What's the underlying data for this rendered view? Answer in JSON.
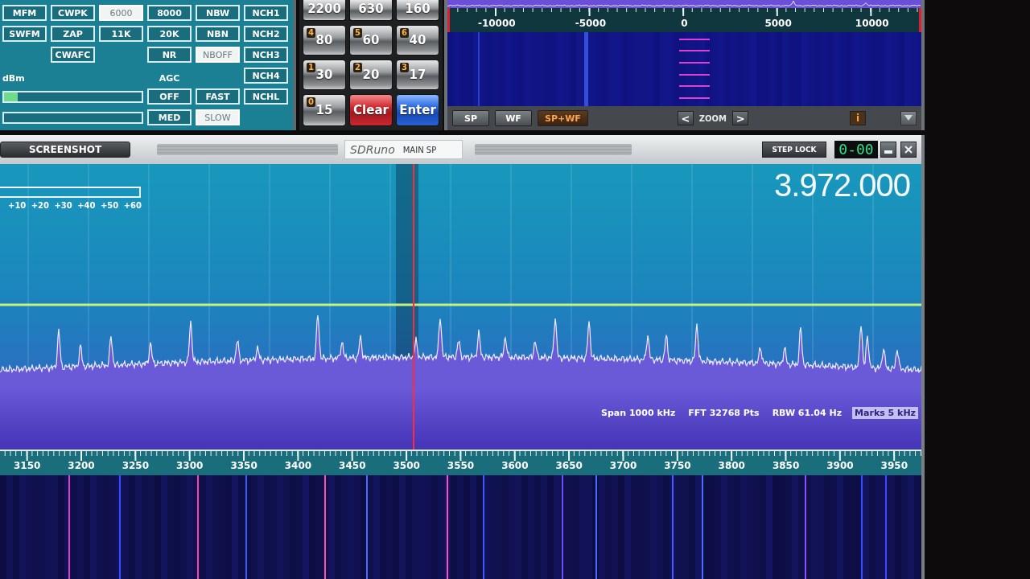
{
  "control_panel": {
    "button_rows": [
      [
        {
          "kind": "button",
          "label": "MFM",
          "selected": false
        },
        {
          "kind": "button",
          "label": "CWPK",
          "selected": false
        },
        {
          "kind": "button",
          "label": "6000",
          "selected": true
        },
        {
          "kind": "button",
          "label": "8000",
          "selected": false
        },
        {
          "kind": "button",
          "label": "NBW",
          "selected": false
        },
        {
          "kind": "button",
          "label": "NCH1",
          "selected": false
        }
      ],
      [
        {
          "kind": "button",
          "label": "SWFM",
          "selected": false
        },
        {
          "kind": "button",
          "label": "ZAP",
          "selected": false
        },
        {
          "kind": "button",
          "label": "11K",
          "selected": false
        },
        {
          "kind": "button",
          "label": "20K",
          "selected": false
        },
        {
          "kind": "button",
          "label": "NBN",
          "selected": false
        },
        {
          "kind": "button",
          "label": "NCH2",
          "selected": false
        }
      ],
      [
        {
          "kind": "gap"
        },
        {
          "kind": "button",
          "label": "CWAFC",
          "selected": false
        },
        {
          "kind": "gap"
        },
        {
          "kind": "button",
          "label": "NR",
          "selected": false
        },
        {
          "kind": "button",
          "label": "NBOFF",
          "selected": true
        },
        {
          "kind": "button",
          "label": "NCH3",
          "selected": false
        }
      ]
    ],
    "notch_buttons": [
      {
        "label": "NCH4",
        "selected": false
      },
      {
        "label": "NCHL",
        "selected": false
      }
    ],
    "signal_meter": {
      "label": "dBm",
      "level": 0.1
    },
    "agc": {
      "label": "AGC",
      "buttons": [
        {
          "label": "OFF",
          "selected": false
        },
        {
          "label": "FAST",
          "selected": false
        },
        {
          "label": "MED",
          "selected": false
        },
        {
          "label": "SLOW",
          "selected": true
        }
      ]
    }
  },
  "keypad": [
    {
      "kind": "number",
      "label": "2200"
    },
    {
      "kind": "number",
      "label": "630"
    },
    {
      "kind": "number",
      "label": "160"
    },
    {
      "kind": "number",
      "digit": "4",
      "label": "80"
    },
    {
      "kind": "number",
      "digit": "5",
      "label": "60"
    },
    {
      "kind": "number",
      "digit": "6",
      "label": "40"
    },
    {
      "kind": "number",
      "digit": "1",
      "label": "30"
    },
    {
      "kind": "number",
      "digit": "2",
      "label": "20"
    },
    {
      "kind": "number",
      "digit": "3",
      "label": "17"
    },
    {
      "kind": "number",
      "digit": "0",
      "label": "15"
    },
    {
      "kind": "clear",
      "label": "Clear"
    },
    {
      "kind": "enter",
      "label": "Enter"
    }
  ],
  "aux_spectrum": {
    "offset_scale": [
      "-10000",
      "-5000",
      "0",
      "5000",
      "10000"
    ],
    "view_buttons": [
      {
        "label": "SP",
        "selected": false
      },
      {
        "label": "WF",
        "selected": false
      },
      {
        "label": "SP+WF",
        "selected": true
      }
    ],
    "zoom": {
      "out": "<",
      "label": "ZOOM",
      "in": ">"
    },
    "info_button": "i"
  },
  "main_spectrum": {
    "title_bar": {
      "screenshot_button": "SCREENSHOT",
      "logo": "SDRuno",
      "title": "MAIN SP",
      "step_lock": "STEP LOCK",
      "step_display": "0-00"
    },
    "frequency": "3.972.000",
    "s_meter_scale": [
      "+10",
      "+20",
      "+30",
      "+40",
      "+50",
      "+60"
    ],
    "info": [
      {
        "text": "Span 1000 kHz",
        "selected": false
      },
      {
        "text": "FFT 32768 Pts",
        "selected": false
      },
      {
        "text": "RBW 61.04 Hz",
        "selected": false
      },
      {
        "text": "Marks 5 kHz",
        "selected": true
      }
    ],
    "frequency_scale": [
      "3150",
      "3200",
      "3250",
      "3300",
      "3350",
      "3400",
      "3450",
      "3500",
      "3550",
      "3600",
      "3650",
      "3700",
      "3750",
      "3800",
      "3850",
      "3900",
      "3950"
    ]
  }
}
